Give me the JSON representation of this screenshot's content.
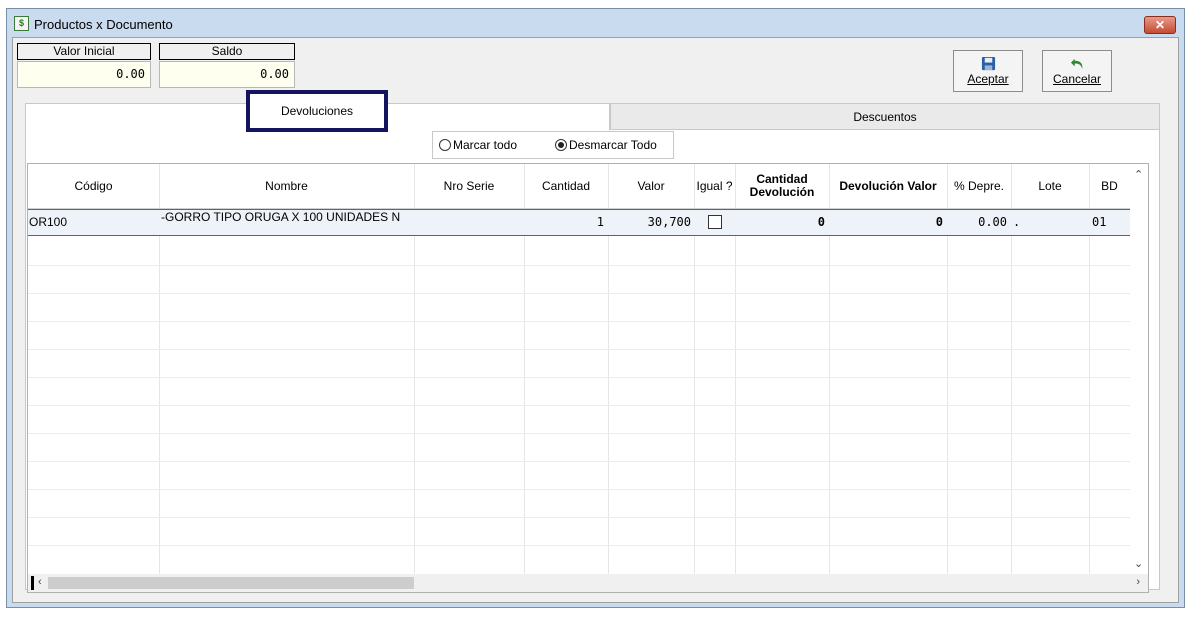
{
  "window": {
    "title": "Productos x Documento",
    "close_label": "✕"
  },
  "fields": {
    "valor_inicial": {
      "label": "Valor Inicial",
      "value": "0.00"
    },
    "saldo": {
      "label": "Saldo",
      "value": "0.00"
    }
  },
  "toolbar": {
    "aceptar_label": "Aceptar",
    "cancelar_label": "Cancelar"
  },
  "tabs": [
    {
      "label": "Devoluciones"
    },
    {
      "label": "Descuentos"
    }
  ],
  "radios": {
    "marcar": "Marcar todo",
    "desmarcar": "Desmarcar Todo",
    "selected": "desmarcar"
  },
  "grid": {
    "columns": [
      {
        "label": "Código",
        "bold": false
      },
      {
        "label": "Nombre",
        "bold": false
      },
      {
        "label": "Nro Serie",
        "bold": false
      },
      {
        "label": "Cantidad",
        "bold": false
      },
      {
        "label": "Valor",
        "bold": false
      },
      {
        "label": "Igual ?",
        "bold": false
      },
      {
        "label": "Cantidad Devolución",
        "bold": true
      },
      {
        "label": "Devolución Valor",
        "bold": true
      },
      {
        "label": "% Depre.",
        "bold": false
      },
      {
        "label": "Lote",
        "bold": false
      },
      {
        "label": "BD",
        "bold": false
      }
    ],
    "row": {
      "codigo": "OR100",
      "nombre": "-GORRO TIPO ORUGA X 100 UNIDADES N",
      "nro_serie": "",
      "cantidad": "1",
      "valor": "30,700",
      "igual": false,
      "cantidad_devolucion": "0",
      "devolucion_valor": "0",
      "depre": "0.00",
      "lote": ".",
      "bd": "01"
    }
  },
  "colors": {
    "highlight_border": "#14145e",
    "selection_border": "#2f6fb6",
    "value_bg": "#fffff0"
  }
}
